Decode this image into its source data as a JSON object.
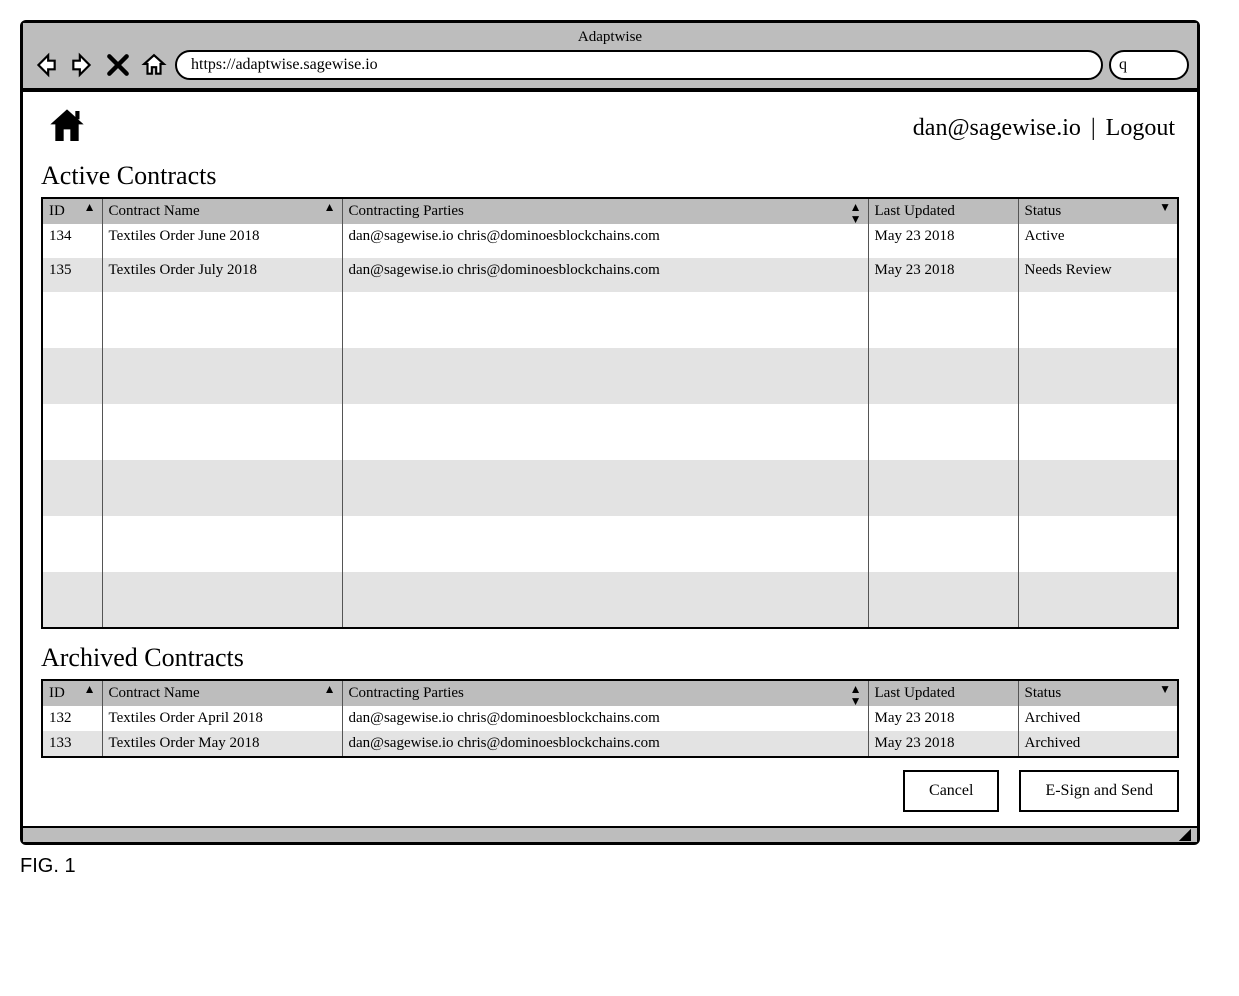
{
  "browser": {
    "title": "Adaptwise",
    "url": "https://adaptwise.sagewise.io",
    "search_icon_label": "q"
  },
  "header": {
    "user_email": "dan@sagewise.io",
    "separator": "|",
    "logout_label": "Logout"
  },
  "sections": {
    "active_title": "Active Contracts",
    "archived_title": "Archived Contracts"
  },
  "columns": {
    "id": "ID",
    "name": "Contract Name",
    "parties": "Contracting Parties",
    "updated": "Last Updated",
    "status": "Status"
  },
  "active_rows": [
    {
      "id": "134",
      "name": "Textiles Order June 2018",
      "parties": "dan@sagewise.io chris@dominoesblockchains.com",
      "updated": "May 23 2018",
      "status": "Active"
    },
    {
      "id": "135",
      "name": "Textiles Order July 2018",
      "parties": "dan@sagewise.io chris@dominoesblockchains.com",
      "updated": "May 23 2018",
      "status": "Needs Review"
    }
  ],
  "archived_rows": [
    {
      "id": "132",
      "name": "Textiles Order April 2018",
      "parties": "dan@sagewise.io chris@dominoesblockchains.com",
      "updated": "May 23 2018",
      "status": "Archived"
    },
    {
      "id": "133",
      "name": "Textiles Order May 2018",
      "parties": "dan@sagewise.io chris@dominoesblockchains.com",
      "updated": "May 23 2018",
      "status": "Archived"
    }
  ],
  "buttons": {
    "cancel": "Cancel",
    "esign": "E-Sign and Send"
  },
  "figure_label": "FIG. 1"
}
